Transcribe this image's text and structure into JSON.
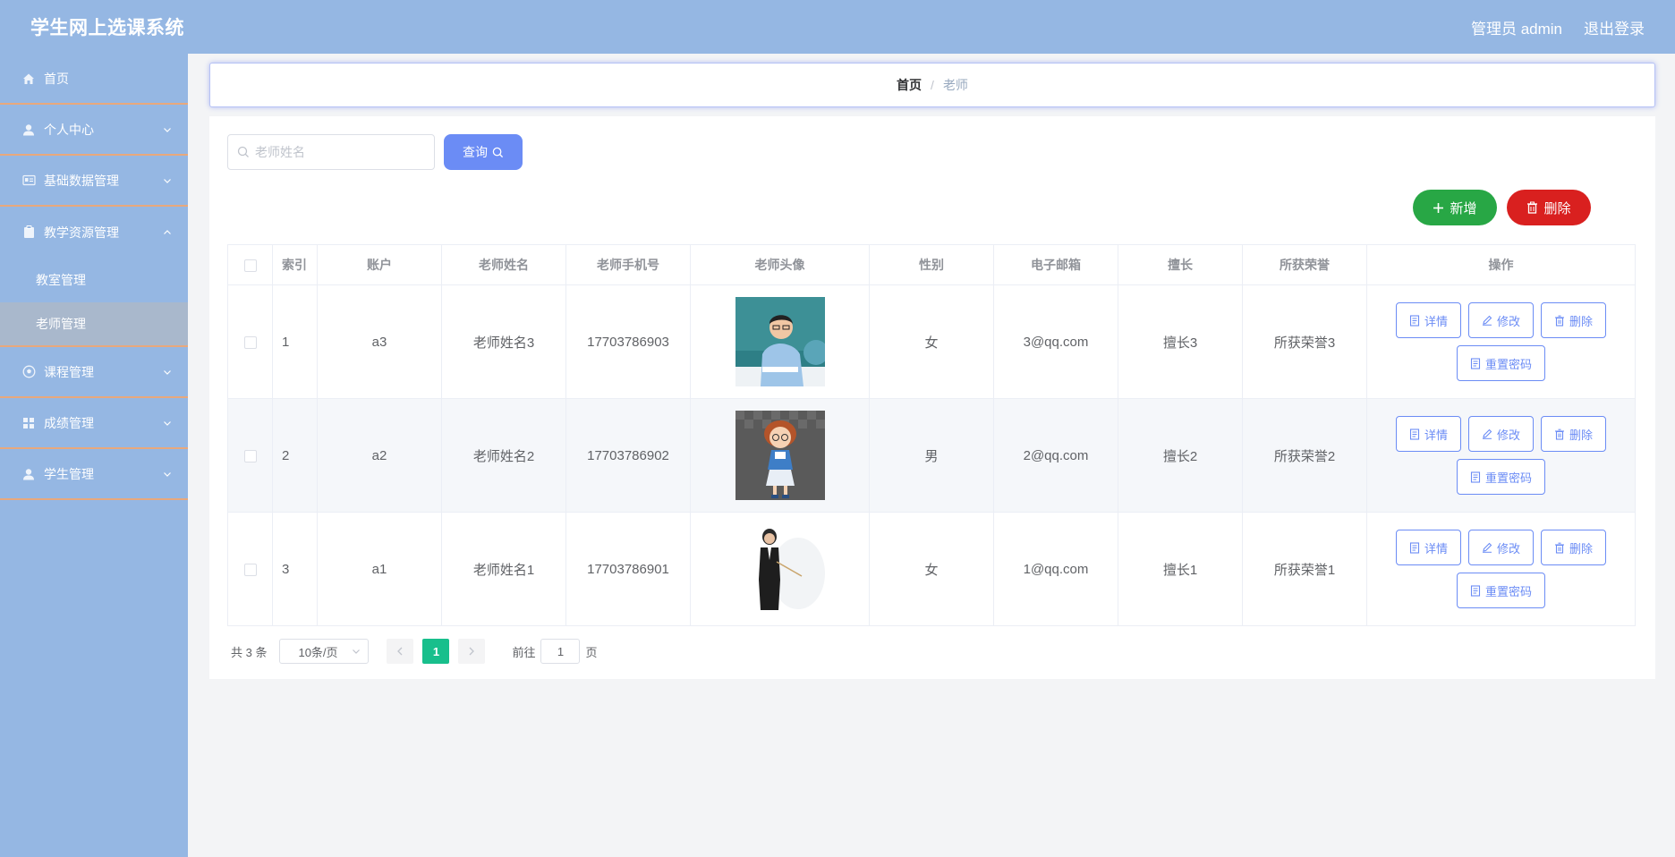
{
  "header": {
    "title": "学生网上选课系统",
    "user_label": "管理员 admin",
    "logout_label": "退出登录"
  },
  "sidebar": {
    "items": [
      {
        "label": "首页",
        "icon": "home-icon"
      },
      {
        "label": "个人中心",
        "icon": "user-icon"
      },
      {
        "label": "基础数据管理",
        "icon": "id-card-icon"
      },
      {
        "label": "教学资源管理",
        "icon": "clipboard-icon"
      },
      {
        "label": "教室管理",
        "sub": true
      },
      {
        "label": "老师管理",
        "sub": true,
        "active": true
      },
      {
        "label": "课程管理",
        "icon": "football-icon"
      },
      {
        "label": "成绩管理",
        "icon": "grid-icon"
      },
      {
        "label": "学生管理",
        "icon": "user-icon"
      }
    ]
  },
  "breadcrumb": {
    "home": "首页",
    "separator": "/",
    "current": "老师"
  },
  "search": {
    "placeholder": "老师姓名",
    "button_label": "查询"
  },
  "actions": {
    "add_label": "新增",
    "delete_label": "删除"
  },
  "table": {
    "columns": [
      "索引",
      "账户",
      "老师姓名",
      "老师手机号",
      "老师头像",
      "性别",
      "电子邮箱",
      "擅长",
      "所获荣誉",
      "操作"
    ],
    "rows": [
      {
        "index": "1",
        "account": "a3",
        "name": "老师姓名3",
        "phone": "17703786903",
        "avatar": "man-at-desk-photo",
        "gender": "女",
        "email": "3@qq.com",
        "skill": "擅长3",
        "honor": "所获荣誉3"
      },
      {
        "index": "2",
        "account": "a2",
        "name": "老师姓名2",
        "phone": "17703786902",
        "avatar": "cartoon-teacher-girl",
        "gender": "男",
        "email": "2@qq.com",
        "skill": "擅长2",
        "honor": "所获荣誉2"
      },
      {
        "index": "3",
        "account": "a1",
        "name": "老师姓名1",
        "phone": "17703786901",
        "avatar": "woman-with-pointer",
        "gender": "女",
        "email": "1@qq.com",
        "skill": "擅长1",
        "honor": "所获荣誉1"
      }
    ],
    "row_actions": {
      "detail": "详情",
      "edit": "修改",
      "delete": "删除",
      "reset": "重置密码"
    }
  },
  "pagination": {
    "total_text": "共 3 条",
    "page_size": "10条/页",
    "current_page": "1",
    "goto_prefix": "前往",
    "goto_value": "1",
    "goto_suffix": "页"
  },
  "colors": {
    "header_bg": "#95b7e3",
    "primary": "#6b8cf5",
    "success": "#28a745",
    "danger": "#d9201f",
    "pager_active": "#18bf8c"
  }
}
